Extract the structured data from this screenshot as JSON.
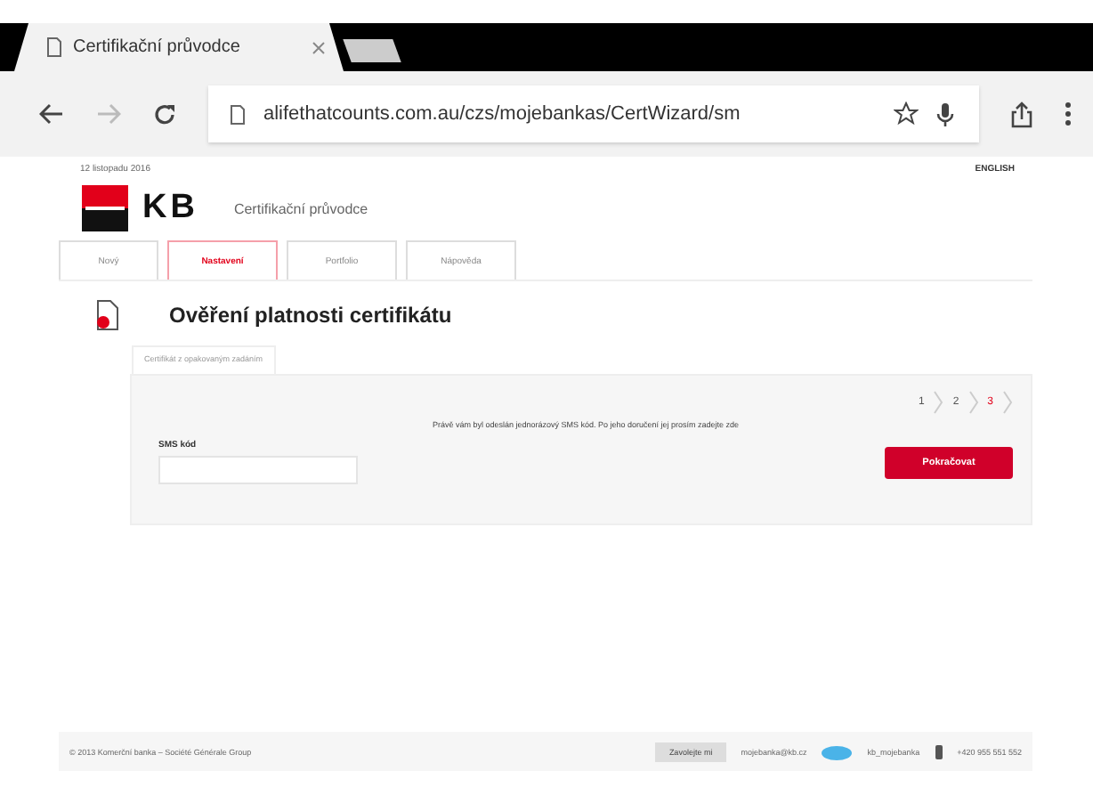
{
  "browser": {
    "tab_title": "Certifikační průvodce",
    "address": "alifethatcounts.com.au/czs/mojebankas/CertWizard/sm"
  },
  "page": {
    "date": "12 listopadu 2016",
    "language": "ENGLISH",
    "logo_text": "KB",
    "app_title": "Certifikační průvodce",
    "tabs": [
      {
        "label": "Nový",
        "selected": false
      },
      {
        "label": "Nastavení",
        "selected": true
      },
      {
        "label": "Portfolio",
        "selected": false
      },
      {
        "label": "Nápověda",
        "selected": false
      }
    ],
    "heading": "Ověření platnosti certifikátu",
    "panel_tab": "Certifikát z opakovaným zadáním",
    "steps": [
      {
        "label": "1",
        "selected": false
      },
      {
        "label": "2",
        "selected": false
      },
      {
        "label": "3",
        "selected": true
      }
    ],
    "message": "Právě vám byl odeslán jednorázový SMS kód. Po jeho doručení jej prosím zadejte zde",
    "sms_label": "SMS kód",
    "submit": "Pokračovat"
  },
  "footer": {
    "copyright": "© 2013 Komerční banka – Société Générale Group",
    "call_button": "Zavolejte mi",
    "email": "mojebanka@kb.cz",
    "social": "kb_mojebanka",
    "phone": "+420 955 551 552"
  }
}
